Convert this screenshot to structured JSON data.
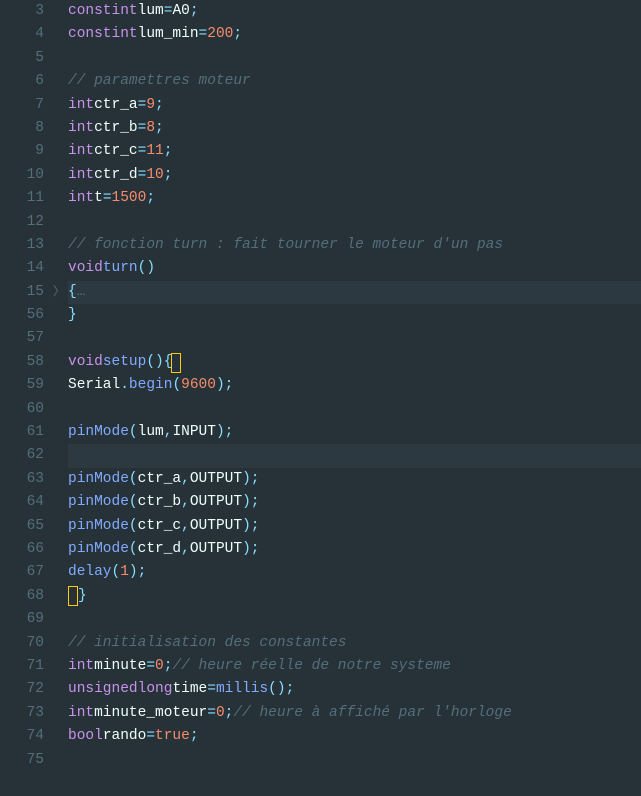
{
  "lines": [
    {
      "n": 3,
      "html": "<span class='kw'>const</span> <span class='type'>int</span> <span class='ident'>lum</span><span class='op'>=</span><span class='const'>A0</span><span class='punct'>;</span>"
    },
    {
      "n": 4,
      "html": "<span class='kw'>const</span> <span class='type'>int</span> <span class='ident'>lum_min</span><span class='op'>=</span><span class='num'>200</span><span class='punct'>;</span>"
    },
    {
      "n": 5,
      "html": ""
    },
    {
      "n": 6,
      "html": "<span class='cmt'>// paramettres moteur</span>"
    },
    {
      "n": 7,
      "html": "<span class='type'>int</span> <span class='ident'>ctr_a</span> <span class='op'>=</span><span class='num'>9</span><span class='punct'>;</span>"
    },
    {
      "n": 8,
      "html": "<span class='type'>int</span> <span class='ident'>ctr_b</span> <span class='op'>=</span><span class='num'>8</span><span class='punct'>;</span>"
    },
    {
      "n": 9,
      "html": "<span class='type'>int</span> <span class='ident'>ctr_c</span> <span class='op'>=</span><span class='num'>11</span><span class='punct'>;</span>"
    },
    {
      "n": 10,
      "html": "<span class='type'>int</span> <span class='ident'>ctr_d</span> <span class='op'>=</span><span class='num'>10</span><span class='punct'>;</span>"
    },
    {
      "n": 11,
      "html": "<span class='type'>int</span> <span class='ident'>t</span><span class='op'>=</span><span class='num'>1500</span><span class='punct'>;</span>"
    },
    {
      "n": 12,
      "html": ""
    },
    {
      "n": 13,
      "html": "<span class='cmt'>// fonction turn : fait tourner le moteur d'un pas</span>"
    },
    {
      "n": 14,
      "html": "<span class='kw'>void</span> <span class='fn'>turn</span> <span class='punct'>()</span>"
    },
    {
      "n": 15,
      "html": "<span class='brace'>{</span>   <span class='fold-placeholder'>…</span>",
      "fold": ">",
      "hl": true
    },
    {
      "n": 56,
      "html": "<span class='brace'>}</span>"
    },
    {
      "n": 57,
      "html": ""
    },
    {
      "n": 58,
      "html": "<span class='kw'>void</span> <span class='fn'>setup</span><span class='punct'>()</span> <span class='brace'>{</span><span class='cursor-box'></span>"
    },
    {
      "n": 59,
      "html": "  <span class='obj'>Serial</span><span class='punct'>.</span><span class='member'>begin</span><span class='punct'>(</span><span class='num'>9600</span><span class='punct'>);</span>"
    },
    {
      "n": 60,
      "html": ""
    },
    {
      "n": 61,
      "html": "  <span class='call'>pinMode</span><span class='punct'>(</span><span class='ident'>lum</span><span class='punct'>,</span><span class='const'>INPUT</span><span class='punct'>);</span>"
    },
    {
      "n": 62,
      "html": "",
      "hl": true
    },
    {
      "n": 63,
      "html": "  <span class='call'>pinMode</span><span class='punct'>(</span><span class='ident'>ctr_a</span><span class='punct'>,</span><span class='const'>OUTPUT</span><span class='punct'>);</span>"
    },
    {
      "n": 64,
      "html": "  <span class='call'>pinMode</span><span class='punct'>(</span><span class='ident'>ctr_b</span><span class='punct'>,</span><span class='const'>OUTPUT</span><span class='punct'>);</span>"
    },
    {
      "n": 65,
      "html": "  <span class='call'>pinMode</span><span class='punct'>(</span><span class='ident'>ctr_c</span><span class='punct'>,</span><span class='const'>OUTPUT</span><span class='punct'>);</span>"
    },
    {
      "n": 66,
      "html": "  <span class='call'>pinMode</span><span class='punct'>(</span><span class='ident'>ctr_d</span><span class='punct'>,</span><span class='const'>OUTPUT</span><span class='punct'>);</span>"
    },
    {
      "n": 67,
      "html": "  <span class='call'>delay</span><span class='punct'>(</span><span class='num'>1</span><span class='punct'>);</span>"
    },
    {
      "n": 68,
      "html": "<span class='cursor-box2'></span><span class='brace'>}</span>"
    },
    {
      "n": 69,
      "html": ""
    },
    {
      "n": 70,
      "html": "<span class='cmt'>// initialisation des constantes</span>"
    },
    {
      "n": 71,
      "html": "<span class='type'>int</span> <span class='ident'>minute</span><span class='op'>=</span><span class='num'>0</span><span class='punct'>;</span>   <span class='cmt'>// heure réelle de notre systeme</span>"
    },
    {
      "n": 72,
      "html": "<span class='type'>unsigned</span> <span class='type'>long</span> <span class='ident'>time</span> <span class='op'>=</span> <span class='call'>millis</span><span class='punct'>();</span>"
    },
    {
      "n": 73,
      "html": "<span class='type'>int</span> <span class='ident'>minute_moteur</span><span class='op'>=</span><span class='num'>0</span><span class='punct'>;</span>   <span class='cmt'>// heure à affiché par l'horloge</span>"
    },
    {
      "n": 74,
      "html": "<span class='type'>bool</span> <span class='ident'>rando</span> <span class='op'>=</span> <span class='true'>true</span><span class='punct'>;</span>"
    },
    {
      "n": 75,
      "html": ""
    }
  ]
}
